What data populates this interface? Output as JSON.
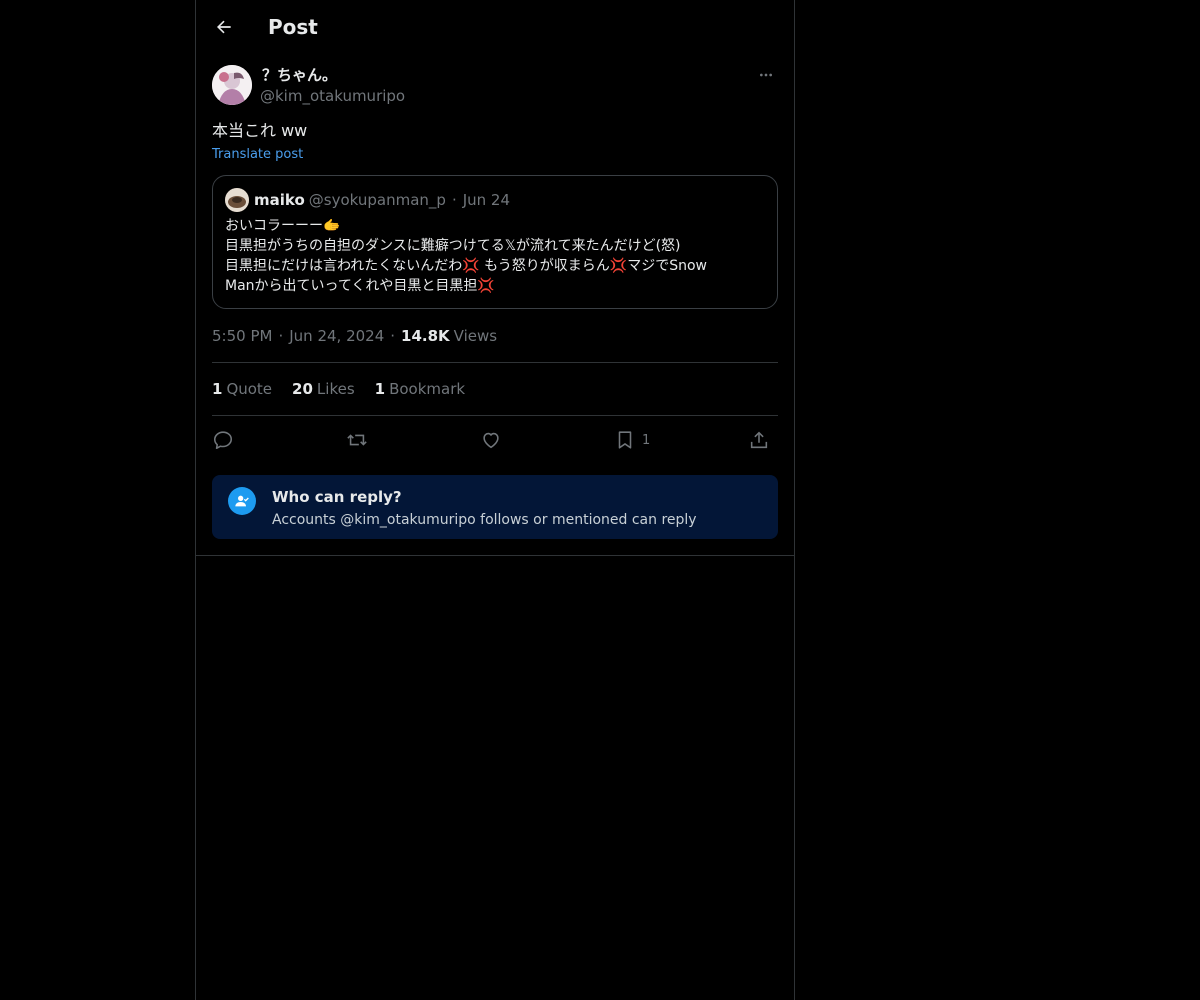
{
  "header": {
    "title": "Post"
  },
  "post": {
    "author": {
      "display_name": "？ちゃん。",
      "handle": "@kim_otakumuripo"
    },
    "text": "本当これ ww",
    "translate_label": "Translate post",
    "quoted": {
      "display_name": "maiko",
      "handle": "@syokupanman_p",
      "date": "Jun 24",
      "lines": [
        "おいコラーーー🫱",
        "目黒担がうちの自担のダンスに難癖つけてる𝕏が流れて来たんだけど(怒)",
        "目黒担にだけは言われたくないんだわ💢 もう怒りが収まらん💢マジでSnow",
        "Manから出ていってくれや目黒と目黒担💢"
      ]
    },
    "time": "5:50 PM",
    "date": "Jun 24, 2024",
    "views_count": "14.8K",
    "views_label": "Views"
  },
  "stats": {
    "quotes": {
      "count": "1",
      "label": "Quote"
    },
    "likes": {
      "count": "20",
      "label": "Likes"
    },
    "bookmarks": {
      "count": "1",
      "label": "Bookmark"
    }
  },
  "actions": {
    "bookmark_count": "1",
    "icons": [
      "reply-icon",
      "repost-icon",
      "like-icon",
      "bookmark-icon",
      "share-icon"
    ]
  },
  "reply_restriction": {
    "title": "Who can reply?",
    "description": "Accounts @kim_otakumuripo follows or mentioned can reply"
  },
  "colors": {
    "background": "#000000",
    "text": "#e7e9ea",
    "muted": "#71767b",
    "link": "#4a9eed",
    "accent": "#1d9bf0",
    "reply_box": "#031637"
  }
}
